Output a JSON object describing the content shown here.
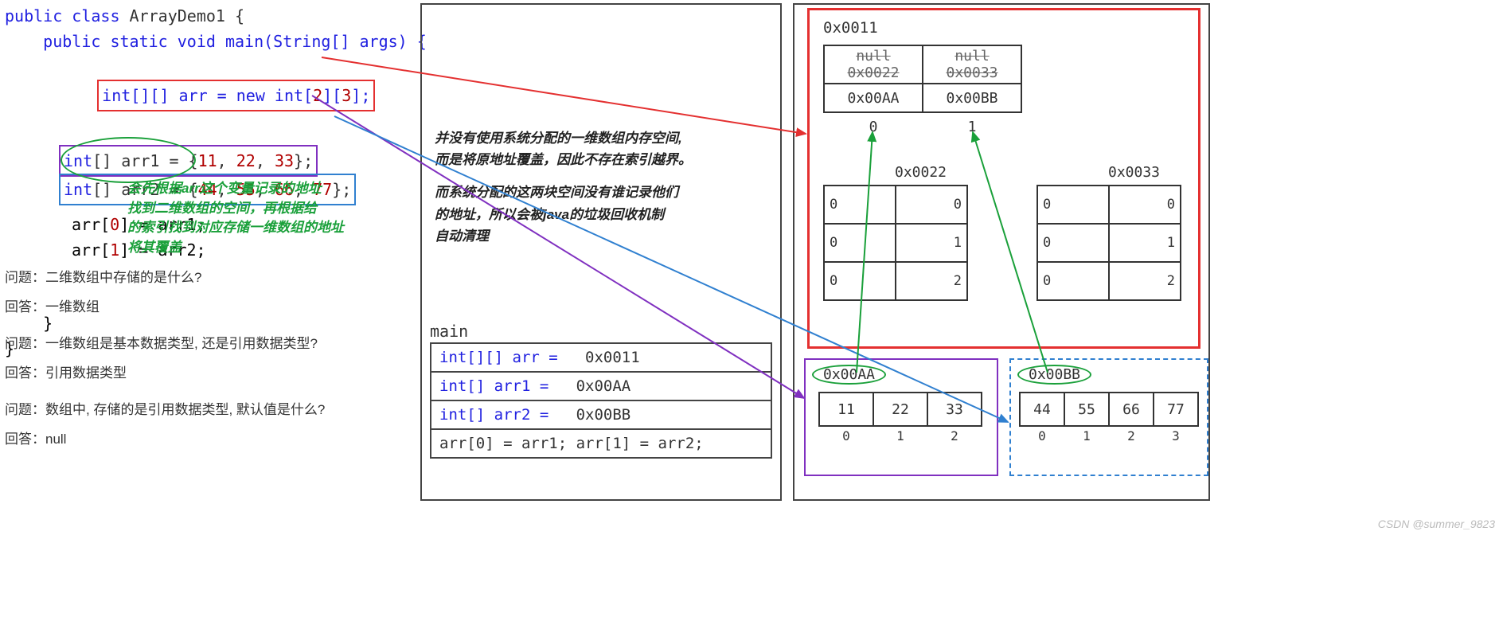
{
  "code": {
    "class_decl_pre": "public class ",
    "class_name": "ArrayDemo1",
    "class_open": " {",
    "main_decl": "    public static void main(String[] args) {",
    "line_new_arr_pre": "int[][] arr = ",
    "line_new_arr_kw": "new ",
    "line_new_arr_type": "int[",
    "line_new_arr_n1": "2",
    "line_new_arr_mid": "][",
    "line_new_arr_n2": "3",
    "line_new_arr_end": "];",
    "line_arr1": "int[] arr1 = {11, 22, 33};",
    "line_arr2": "int[] arr2 = {44, 55, 66, 77};",
    "line_assign1": "arr[0] = arr1;",
    "line_assign2": "arr[1] = arr2;",
    "close_inner": "    }",
    "close_class": "}"
  },
  "green_note": {
    "l1": "会先根据arr这个变量记录的地址",
    "l2": "找到二维数组的空间，再根据给",
    "l3": "的索引找到对应存储一维数组的地址",
    "l4": "将其覆盖"
  },
  "qa": {
    "q1": "问题：二维数组中存储的是什么?",
    "a1": "回答：一维数组",
    "q2": "问题：一维数组是基本数据类型, 还是引用数据类型?",
    "a2": "回答：引用数据类型",
    "q3": "问题：数组中, 存储的是引用数据类型, 默认值是什么?",
    "a3": "回答：null"
  },
  "italic": {
    "p1a": "并没有使用系统分配的一维数组内存空间,",
    "p1b": "而是将原地址覆盖，因此不存在索引越界。",
    "p2a": "而系统分配的这两块空间没有谁记录他们",
    "p2b": "的地址，所以会被java的垃圾回收机制",
    "p2c": "自动清理"
  },
  "stack": {
    "label": "main",
    "r1_decl": "int[][] arr = ",
    "r1_val": "0x0011",
    "r2_decl": "int[] arr1 = ",
    "r2_val": "0x00AA",
    "r3_decl": "int[] arr2 = ",
    "r3_val": "0x00BB",
    "r4": "arr[0] = arr1;   arr[1] = arr2;"
  },
  "heap": {
    "arr_addr": "0x0011",
    "arr_cell0_old": "null",
    "arr_cell0_old2": "0x0022",
    "arr_cell0_new": "0x00AA",
    "arr_cell1_old": "null",
    "arr_cell1_old2": "0x0033",
    "arr_cell1_new": "0x00BB",
    "idx0": "0",
    "idx1": "1",
    "sub1_addr": "0x0022",
    "sub2_addr": "0x0033",
    "zero": "0",
    "one": "1",
    "two": "2",
    "three": "3",
    "aa_addr": "0x00AA",
    "aa_vals": [
      "11",
      "22",
      "33"
    ],
    "bb_addr": "0x00BB",
    "bb_vals": [
      "44",
      "55",
      "66",
      "77"
    ]
  },
  "watermark": "CSDN @summer_9823"
}
